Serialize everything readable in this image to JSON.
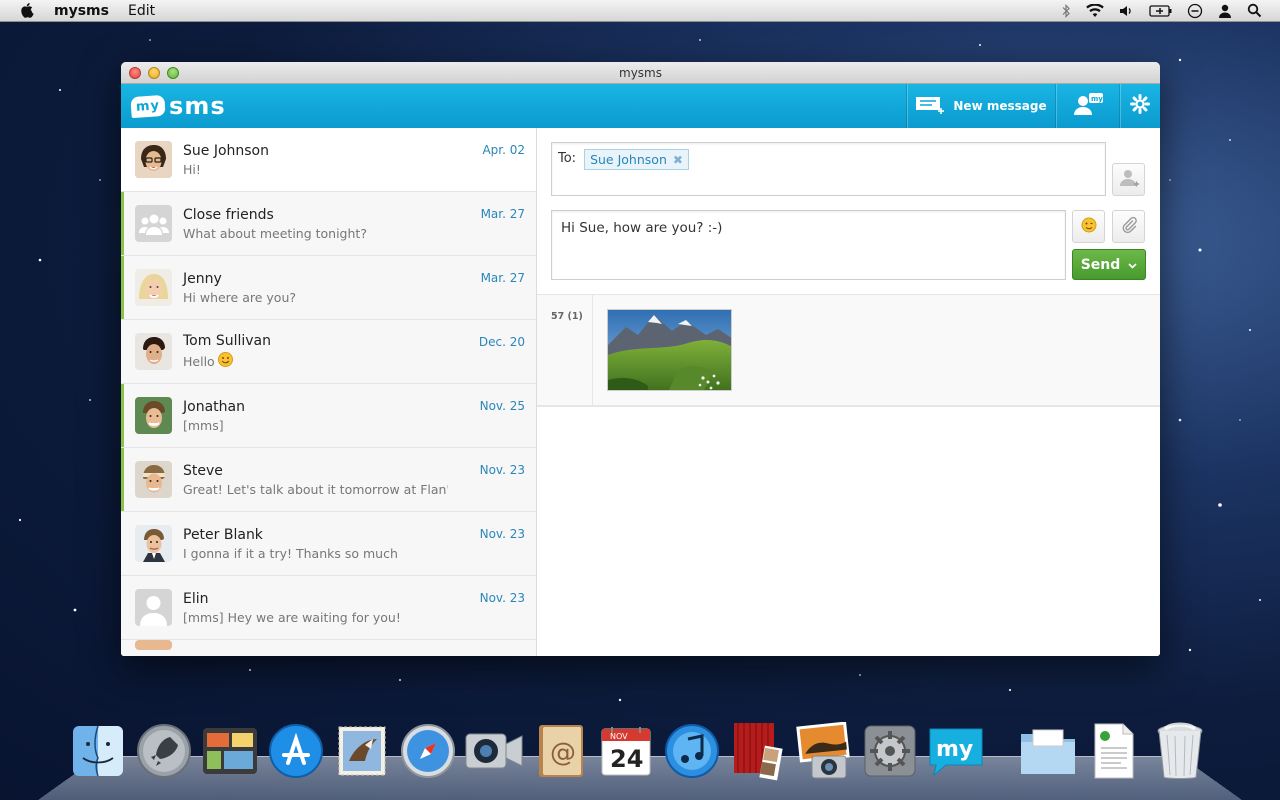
{
  "menubar": {
    "app_name": "mysms",
    "menu_edit": "Edit"
  },
  "window": {
    "title": "mysms"
  },
  "appbar": {
    "logo_badge": "my",
    "logo_text": "sms",
    "new_message_label": "New message"
  },
  "conversations": [
    {
      "name": "Sue Johnson",
      "preview": "Hi!",
      "date": "Apr. 02",
      "avatar": "photo-female-glasses",
      "active": true
    },
    {
      "name": "Close friends",
      "preview": "What about meeting tonight?",
      "date": "Mar. 27",
      "avatar": "group-icon",
      "unread": true
    },
    {
      "name": "Jenny",
      "preview": "Hi where are you?",
      "date": "Mar. 27",
      "avatar": "photo-female-blonde",
      "unread": true
    },
    {
      "name": "Tom Sullivan",
      "preview": "Hello",
      "date": "Dec. 20",
      "avatar": "photo-male-dark",
      "emoji": "smiley-icon"
    },
    {
      "name": "Jonathan",
      "preview": "[mms]",
      "date": "Nov. 25",
      "avatar": "photo-male-young",
      "unread": true
    },
    {
      "name": "Steve",
      "preview": "Great! Let's talk about it tomorrow at Flan'...",
      "date": "Nov. 23",
      "avatar": "photo-male-headband",
      "unread": true
    },
    {
      "name": "Peter Blank",
      "preview": "I gonna if it a try! Thanks so much",
      "date": "Nov. 23",
      "avatar": "photo-male-suit"
    },
    {
      "name": "Elin",
      "preview": "[mms] Hey we are waiting for you!",
      "date": "Nov. 23",
      "avatar": "person-placeholder-icon"
    }
  ],
  "compose": {
    "to_label": "To:",
    "recipient": "Sue Johnson",
    "message": "Hi Sue, how are you? :-)",
    "send_label": "Send"
  },
  "thread": {
    "meta": "57 (1)"
  },
  "colors": {
    "accent": "#11a8dc",
    "send_green": "#55a838",
    "link_blue": "#2b86b9",
    "unread_marker": "#8bc34a"
  },
  "dock": [
    "finder-icon",
    "launchpad-icon",
    "mission-control-icon",
    "app-store-icon",
    "mail-icon",
    "safari-icon",
    "facetime-icon",
    "contacts-icon",
    "calendar-icon",
    "itunes-icon",
    "photo-booth-icon",
    "iphoto-icon",
    "system-preferences-icon",
    "mysms-icon",
    "documents-folder-icon",
    "document-file-icon",
    "trash-icon"
  ],
  "dock_calendar": {
    "month": "NOV",
    "day": "24"
  }
}
